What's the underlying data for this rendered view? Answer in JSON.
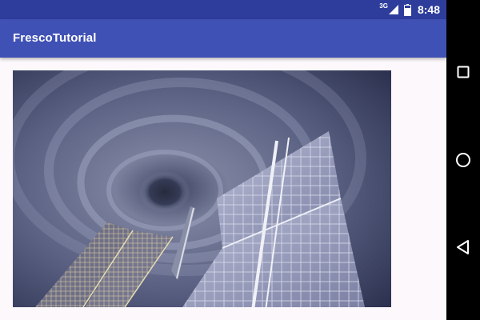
{
  "status_bar": {
    "network_type": "3G",
    "time": "8:48",
    "icons": [
      "signal-icon",
      "battery-icon"
    ]
  },
  "app_bar": {
    "title": "FrescoTutorial"
  },
  "image_view": {
    "subject": "Space station solar arrays over hurricane"
  },
  "nav_bar": {
    "buttons": [
      "recents-icon",
      "home-icon",
      "back-icon"
    ]
  },
  "colors": {
    "status_bar": "#2e3d9c",
    "app_bar": "#3f51b5",
    "background": "#fcf8fc",
    "nav_bar": "#000000"
  }
}
